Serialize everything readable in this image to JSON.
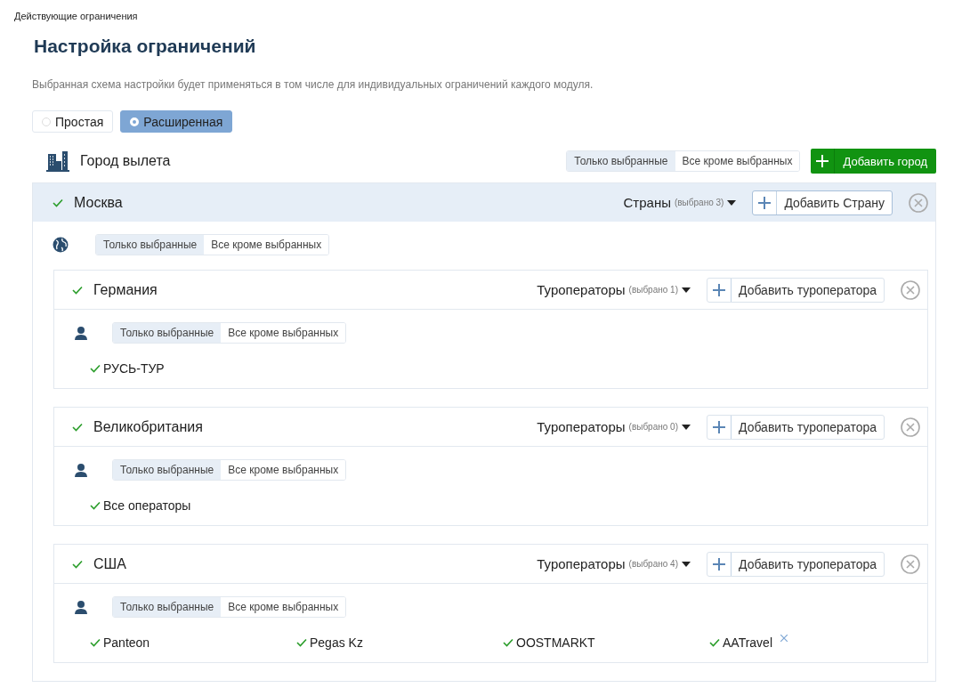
{
  "breadcrumb": "Действующие ограничения",
  "title": "Настройка ограничений",
  "description": "Выбранная схема настройки будет применяться в том числе для индивидуальных ограничений каждого модуля.",
  "modes": [
    {
      "label": "Простая",
      "selected": false
    },
    {
      "label": "Расширенная",
      "selected": true
    }
  ],
  "section": {
    "title": "Город вылета",
    "filter": [
      {
        "label": "Только выбранные",
        "selected": true
      },
      {
        "label": "Все кроме выбранных",
        "selected": false
      }
    ],
    "add_button": "Добавить город"
  },
  "cities": [
    {
      "name": "Москва",
      "checked": true,
      "dropdown_label": "Страны",
      "dropdown_count": "(выбрано 3)",
      "add_button": "Добавить Страну",
      "filter": [
        {
          "label": "Только выбранные",
          "selected": true
        },
        {
          "label": "Все кроме выбранных",
          "selected": false
        }
      ],
      "countries": [
        {
          "name": "Германия",
          "checked": true,
          "dropdown_label": "Туроператоры",
          "dropdown_count": "(выбрано 1)",
          "add_button": "Добавить туроператора",
          "filter": [
            {
              "label": "Только выбранные",
              "selected": true
            },
            {
              "label": "Все кроме выбранных",
              "selected": false
            }
          ],
          "operators": [
            {
              "name": "РУСЬ-ТУР",
              "checked": true,
              "removable": false
            }
          ]
        },
        {
          "name": "Великобритания",
          "checked": true,
          "dropdown_label": "Туроператоры",
          "dropdown_count": "(выбрано 0)",
          "add_button": "Добавить туроператора",
          "filter": [
            {
              "label": "Только выбранные",
              "selected": true
            },
            {
              "label": "Все кроме выбранных",
              "selected": false
            }
          ],
          "operators": [
            {
              "name": "Все операторы",
              "checked": true,
              "removable": false
            }
          ]
        },
        {
          "name": "США",
          "checked": true,
          "dropdown_label": "Туроператоры",
          "dropdown_count": "(выбрано 4)",
          "add_button": "Добавить туроператора",
          "filter": [
            {
              "label": "Только выбранные",
              "selected": true
            },
            {
              "label": "Все кроме выбранных",
              "selected": false
            }
          ],
          "operators": [
            {
              "name": "Panteon",
              "checked": true,
              "removable": false
            },
            {
              "name": "Pegas Kz",
              "checked": true,
              "removable": false
            },
            {
              "name": "OOSTMARKT",
              "checked": true,
              "removable": false
            },
            {
              "name": "AATravel",
              "checked": true,
              "removable": true
            }
          ]
        }
      ]
    }
  ]
}
